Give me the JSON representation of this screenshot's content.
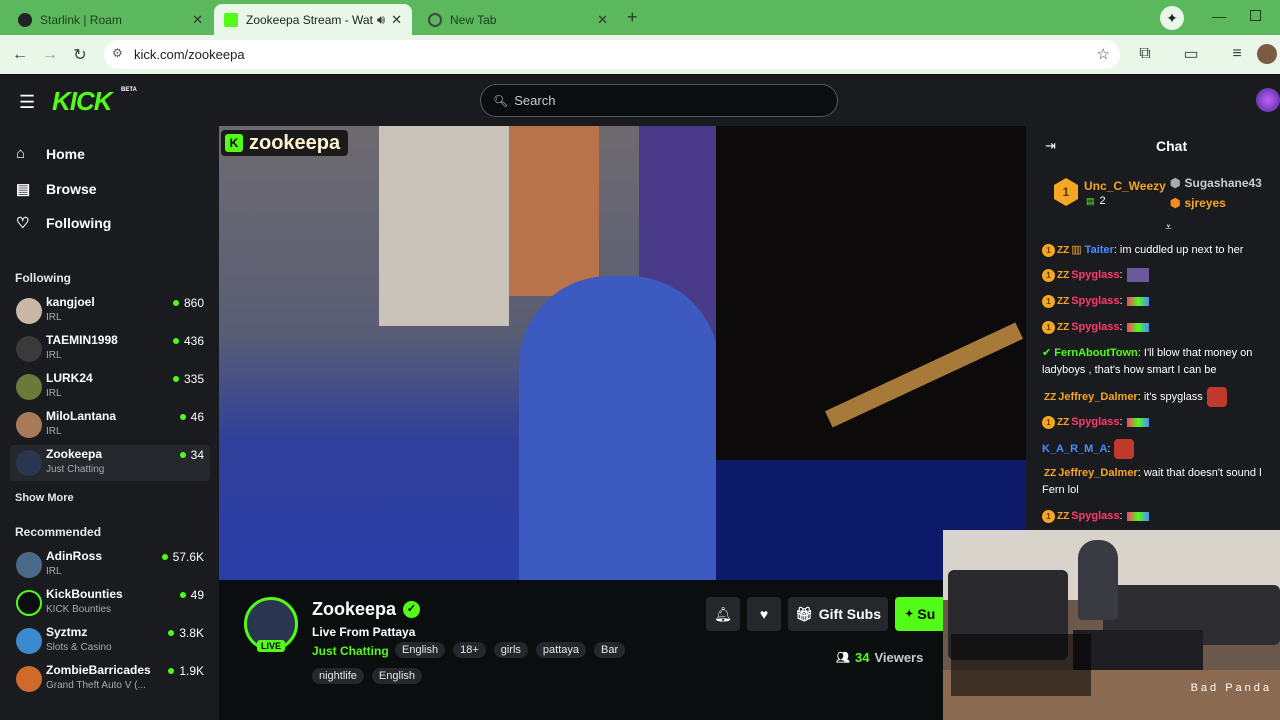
{
  "browser": {
    "tabs": [
      {
        "title": "Starlink | Roam"
      },
      {
        "title": "Zookeepa Stream - Watch l"
      },
      {
        "title": "New Tab"
      }
    ],
    "new_tab": "+",
    "url": "kick.com/zookeepa"
  },
  "kick": {
    "logo": "KICK",
    "beta": "BETA",
    "search_placeholder": "Search",
    "nav": {
      "home": "Home",
      "browse": "Browse",
      "following": "Following"
    },
    "following_heading": "Following",
    "following": [
      {
        "name": "kangjoel",
        "category": "IRL",
        "viewers": "860"
      },
      {
        "name": "TAEMIN1998",
        "category": "IRL",
        "viewers": "436"
      },
      {
        "name": "LURK24",
        "category": "IRL",
        "viewers": "335"
      },
      {
        "name": "MiloLantana",
        "category": "IRL",
        "viewers": "46"
      },
      {
        "name": "Zookeepa",
        "category": "Just Chatting",
        "viewers": "34"
      }
    ],
    "show_more": "Show More",
    "recommended_heading": "Recommended",
    "recommended": [
      {
        "name": "AdinRoss",
        "category": "IRL",
        "viewers": "57.6K"
      },
      {
        "name": "KickBounties",
        "category": "KICK Bounties",
        "viewers": "49"
      },
      {
        "name": "Syztmz",
        "category": "Slots & Casino",
        "viewers": "3.8K"
      },
      {
        "name": "ZombieBarricades",
        "category": "Grand Theft Auto V (...",
        "viewers": "1.9K"
      }
    ]
  },
  "stream": {
    "overlay_name": "zookeepa",
    "channel": "Zookeepa",
    "title": "Live From Pattaya",
    "category": "Just Chatting",
    "live": "LIVE",
    "tags_row1": [
      "English",
      "18+",
      "girls",
      "pattaya",
      "Bar"
    ],
    "tags_row2": [
      "nightlife",
      "English"
    ],
    "gift_subs": "Gift Subs",
    "subscribe": "Su",
    "viewers": "34",
    "viewers_label": "Viewers"
  },
  "chat": {
    "title": "Chat",
    "leaderboard": [
      {
        "rank": "1",
        "name": "Unc_C_Weezy",
        "count": "2"
      },
      {
        "name": "Sugashane43"
      },
      {
        "name": "sjreyes"
      }
    ],
    "messages": [
      {
        "user": "Taiter",
        "color": "#4a8cff",
        "text": ": im cuddled up next to her"
      },
      {
        "user": "Spyglass",
        "color": "#ff3b6b",
        "text": ":"
      },
      {
        "user": "Spyglass",
        "color": "#ff3b6b",
        "text": ":"
      },
      {
        "user": "Spyglass",
        "color": "#ff3b6b",
        "text": ":"
      },
      {
        "user": "FernAboutTown",
        "color": "#53fc18",
        "text": ": I'll blow that money on ladyboys , that's how smart I can be"
      },
      {
        "user": "Jeffrey_Dalmer",
        "color": "#f5a623",
        "text": ": it's spyglass"
      },
      {
        "user": "Spyglass",
        "color": "#ff3b6b",
        "text": ":"
      },
      {
        "user": "K_A_R_M_A",
        "color": "#4a8cff",
        "text": ":"
      },
      {
        "user": "Jeffrey_Dalmer",
        "color": "#f5a623",
        "text": ": wait that doesn't sound l Fern lol"
      },
      {
        "user": "Spyglass",
        "color": "#ff3b6b",
        "text": ":"
      }
    ]
  },
  "pip": {
    "watermark": "Bad Panda"
  }
}
